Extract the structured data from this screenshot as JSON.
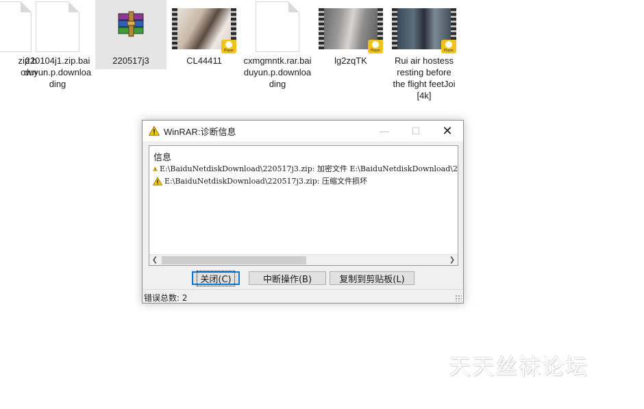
{
  "files": [
    {
      "id": "f0",
      "label": "zip.b\nown",
      "type": "document",
      "selected": false
    },
    {
      "id": "f1",
      "label": "220104j1.zip.baiduyun.p.downloading",
      "type": "document",
      "selected": false
    },
    {
      "id": "f2",
      "label": "220517j3",
      "type": "winrar-archive",
      "selected": true
    },
    {
      "id": "f3",
      "label": "CL44411",
      "type": "video",
      "selected": false
    },
    {
      "id": "f4",
      "label": "cxmgmntk.rar.baiduyun.p.downloading",
      "type": "document",
      "selected": false
    },
    {
      "id": "f5",
      "label": "lg2zqTK",
      "type": "video",
      "selected": false
    },
    {
      "id": "f6",
      "label": "Rui air hostess resting before the flight feetJoi [4k]",
      "type": "video",
      "selected": false
    }
  ],
  "player_badge": "Player",
  "dialog": {
    "title": "WinRAR:诊断信息",
    "window_buttons": {
      "minimize": "—",
      "maximize": "☐",
      "close": "✕"
    },
    "list_header": "信息",
    "messages": [
      {
        "icon": "warning-icon",
        "text": "E:\\BaiduNetdiskDownload\\220517j3.zip: 加密文件 E:\\BaiduNetdiskDownload\\2"
      },
      {
        "icon": "warning-icon",
        "text": "E:\\BaiduNetdiskDownload\\220517j3.zip: 压缩文件损坏"
      }
    ],
    "buttons": {
      "close": "关闭(C)",
      "abort": "中断操作(B)",
      "copy": "复制到剪贴板(L)"
    },
    "status": "错误总数: 2"
  },
  "watermark": "天天丝袜论坛",
  "colors": {
    "accent": "#0078d7",
    "warning": "#f5c400",
    "selection": "#e5e5e5"
  }
}
